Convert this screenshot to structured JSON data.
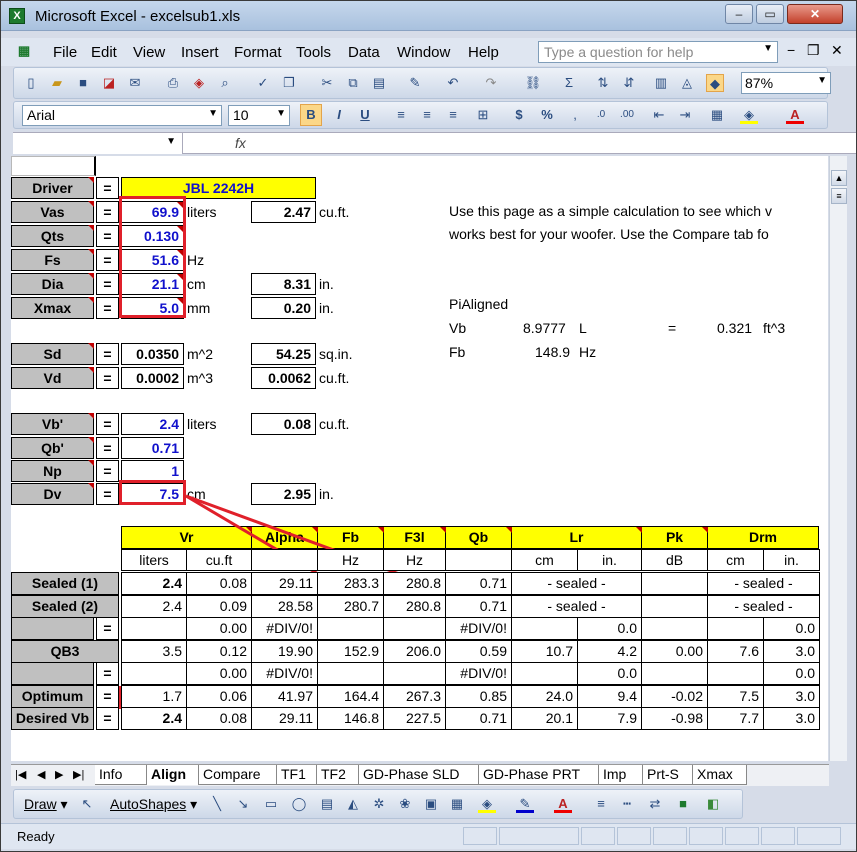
{
  "window": {
    "title": "Microsoft Excel - excelsub1.xls",
    "minimize": "‒",
    "maximize": "▭",
    "close": "✕"
  },
  "menu": {
    "items": [
      "File",
      "Edit",
      "View",
      "Insert",
      "Format",
      "Tools",
      "Data",
      "Window",
      "Help"
    ],
    "help_placeholder": "Type a question for help",
    "mdi_min": "−",
    "mdi_restore": "❐",
    "mdi_close": "✕"
  },
  "toolbar": {
    "zoom": "87%",
    "font": "Arial",
    "size": "10",
    "bold": "B",
    "italic": "I",
    "underline": "U",
    "currency": "$",
    "percent": "%"
  },
  "formula": {
    "fx": "fx"
  },
  "driver": {
    "label": "Driver",
    "eq": "=",
    "name": "JBL 2242H",
    "rows": [
      {
        "label": "Vas",
        "value": "69.9",
        "unit": "liters",
        "conv": "2.47",
        "conv_unit": "cu.ft."
      },
      {
        "label": "Qts",
        "value": "0.130",
        "unit": "",
        "conv": "",
        "conv_unit": ""
      },
      {
        "label": "Fs",
        "value": "51.6",
        "unit": "Hz",
        "conv": "",
        "conv_unit": ""
      },
      {
        "label": "Dia",
        "value": "21.1",
        "unit": "cm",
        "conv": "8.31",
        "conv_unit": "in."
      },
      {
        "label": "Xmax",
        "value": "5.0",
        "unit": "mm",
        "conv": "0.20",
        "conv_unit": "in."
      }
    ],
    "sd": {
      "label": "Sd",
      "value": "0.0350",
      "unit": "m^2",
      "conv": "54.25",
      "conv_unit": "sq.in."
    },
    "vd": {
      "label": "Vd",
      "value": "0.0002",
      "unit": "m^3",
      "conv": "0.0062",
      "conv_unit": "cu.ft."
    },
    "vb": {
      "label": "Vb'",
      "value": "2.4",
      "unit": "liters",
      "conv": "0.08",
      "conv_unit": "cu.ft."
    },
    "qb": {
      "label": "Qb'",
      "value": "0.71"
    },
    "np": {
      "label": "Np",
      "value": "1"
    },
    "dv": {
      "label": "Dv",
      "value": "7.5",
      "unit": "cm",
      "conv": "2.95",
      "conv_unit": "in."
    }
  },
  "note": {
    "line1": "Use this page as a simple calculation to see which v",
    "line2": "works best for your woofer. Use the Compare tab fo",
    "pi_title": "PiAligned",
    "vb_label": "Vb",
    "vb_value": "8.9777",
    "vb_unit": "L",
    "eq": "=",
    "vb_ft": "0.321",
    "vb_ft_unit": "ft^3",
    "fb_label": "Fb",
    "fb_value": "148.9",
    "fb_unit": "Hz"
  },
  "table": {
    "headers": [
      "Vr",
      "Alpha",
      "Fb",
      "F3l",
      "Qb",
      "Lr",
      "Pk",
      "Drm"
    ],
    "units": [
      "liters",
      "cu.ft",
      "",
      "Hz",
      "Hz",
      "",
      "cm",
      "in.",
      "dB",
      "cm",
      "in."
    ],
    "rows": [
      {
        "label": "Sealed (1)",
        "eq": "",
        "cells": [
          "2.4",
          "0.08",
          "29.11",
          "283.3",
          "280.8",
          "0.71",
          "- sealed -",
          "",
          "- sealed -"
        ]
      },
      {
        "label": "Sealed (2)",
        "eq": "",
        "cells": [
          "2.4",
          "0.09",
          "28.58",
          "280.7",
          "280.8",
          "0.71",
          "- sealed -",
          "",
          "- sealed -"
        ]
      },
      {
        "label": "",
        "eq": "=",
        "cells": [
          "",
          "0.00",
          "#DIV/0!",
          "",
          "",
          "#DIV/0!",
          "",
          "0.0",
          "",
          "",
          "0.0"
        ]
      },
      {
        "label": "QB3",
        "eq": "",
        "cells": [
          "3.5",
          "0.12",
          "19.90",
          "152.9",
          "206.0",
          "0.59",
          "10.7",
          "4.2",
          "0.00",
          "7.6",
          "3.0"
        ]
      },
      {
        "label": "",
        "eq": "=",
        "cells": [
          "",
          "0.00",
          "#DIV/0!",
          "",
          "",
          "#DIV/0!",
          "",
          "0.0",
          "",
          "",
          "0.0"
        ]
      },
      {
        "label": "Optimum",
        "eq": "=",
        "cells": [
          "1.7",
          "0.06",
          "41.97",
          "164.4",
          "267.3",
          "0.85",
          "24.0",
          "9.4",
          "-0.02",
          "7.5",
          "3.0"
        ]
      },
      {
        "label": "Desired Vb",
        "eq": "=",
        "cells": [
          "2.4",
          "0.08",
          "29.11",
          "146.8",
          "227.5",
          "0.71",
          "20.1",
          "7.9",
          "-0.98",
          "7.7",
          "3.0"
        ]
      }
    ]
  },
  "tabs": [
    "Info",
    "Align",
    "Compare",
    "TF1",
    "TF2",
    "GD-Phase SLD",
    "GD-Phase PRT",
    "Imp",
    "Prt-S",
    "Xmax"
  ],
  "active_tab": "Align",
  "draw": {
    "draw_label": "Draw",
    "autoshapes_label": "AutoShapes"
  },
  "status": {
    "text": "Ready"
  },
  "colors": {
    "accent_red": "#e0202a",
    "input_blue": "#1010cc",
    "header_yellow": "#ffff00",
    "label_grey": "#c0c0c0"
  }
}
